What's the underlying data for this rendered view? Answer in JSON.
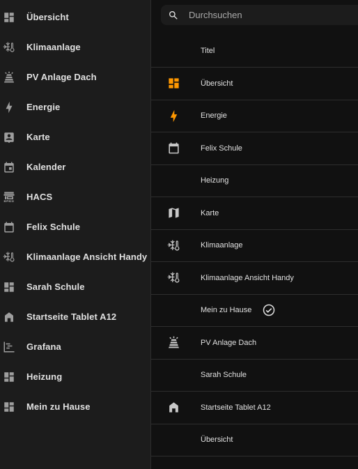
{
  "sidebar": {
    "items": [
      {
        "label": "Übersicht",
        "icon": "dashboard-icon"
      },
      {
        "label": "Klimaanlage",
        "icon": "snowflake-thermometer-icon"
      },
      {
        "label": "PV Anlage Dach",
        "icon": "solar-panel-icon"
      },
      {
        "label": "Energie",
        "icon": "lightning-bolt-icon"
      },
      {
        "label": "Karte",
        "icon": "account-box-icon"
      },
      {
        "label": "Kalender",
        "icon": "calendar-icon"
      },
      {
        "label": "HACS",
        "icon": "hacs-icon"
      },
      {
        "label": "Felix Schule",
        "icon": "calendar-blank-icon"
      },
      {
        "label": "Klimaanlage Ansicht Handy",
        "icon": "snowflake-thermometer-icon"
      },
      {
        "label": "Sarah Schule",
        "icon": "dashboard-icon"
      },
      {
        "label": "Startseite Tablet A12",
        "icon": "home-icon"
      },
      {
        "label": "Grafana",
        "icon": "chart-gantt-icon"
      },
      {
        "label": "Heizung",
        "icon": "dashboard-icon"
      },
      {
        "label": "Mein zu Hause",
        "icon": "dashboard-icon"
      }
    ]
  },
  "search": {
    "placeholder": "Durchsuchen"
  },
  "table": {
    "header": "Titel",
    "rows": [
      {
        "label": "Übersicht",
        "icon": "dashboard-icon",
        "icon_color": "#ff9800"
      },
      {
        "label": "Energie",
        "icon": "lightning-bolt-icon",
        "icon_color": "#ff9800"
      },
      {
        "label": "Felix Schule",
        "icon": "calendar-blank-icon",
        "icon_color": "#c8c8c8"
      },
      {
        "label": "Heizung",
        "icon": "",
        "icon_color": ""
      },
      {
        "label": "Karte",
        "icon": "map-icon",
        "icon_color": "#c8c8c8"
      },
      {
        "label": "Klimaanlage",
        "icon": "snowflake-thermometer-icon",
        "icon_color": "#c8c8c8"
      },
      {
        "label": "Klimaanlage Ansicht Handy",
        "icon": "snowflake-thermometer-icon",
        "icon_color": "#c8c8c8"
      },
      {
        "label": "Mein zu Hause",
        "icon": "",
        "icon_color": "",
        "default_check": true
      },
      {
        "label": "PV Anlage Dach",
        "icon": "solar-panel-icon",
        "icon_color": "#c8c8c8"
      },
      {
        "label": "Sarah Schule",
        "icon": "",
        "icon_color": ""
      },
      {
        "label": "Startseite Tablet A12",
        "icon": "home-icon",
        "icon_color": "#c8c8c8"
      },
      {
        "label": "Übersicht",
        "icon": "",
        "icon_color": ""
      }
    ]
  },
  "colors": {
    "accent": "#ff9800",
    "background": "#111111",
    "sidebar": "#1c1c1c"
  }
}
